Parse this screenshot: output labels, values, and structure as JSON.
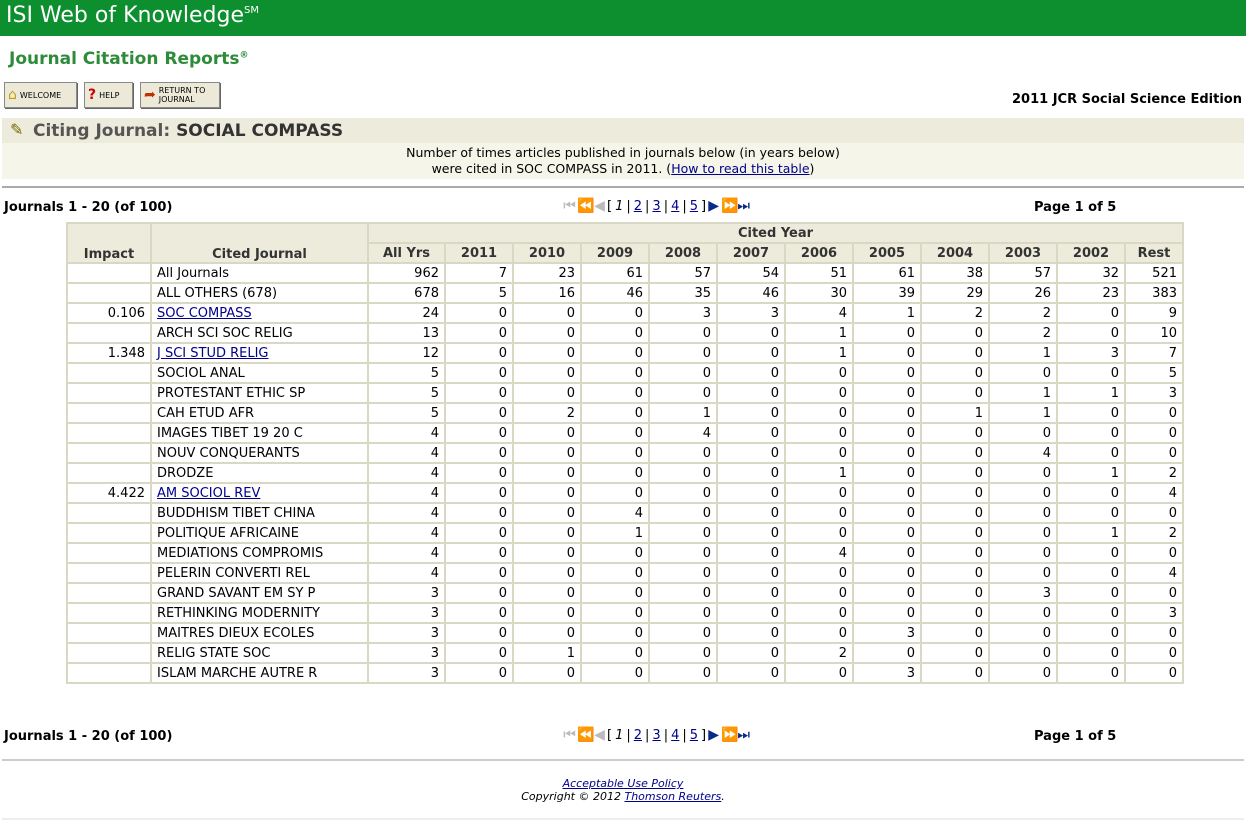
{
  "header": {
    "brand": "ISI Web of Knowledge",
    "brand_mark": "SM",
    "product": "Journal Citation Reports",
    "product_mark": "®"
  },
  "toolbar": {
    "welcome": "WELCOME",
    "help": "HELP",
    "return_line1": "RETURN TO",
    "return_line2": "JOURNAL"
  },
  "edition": "2011 JCR Social Science Edition",
  "citing": {
    "label": "Citing Journal:",
    "journal": "SOCIAL COMPASS"
  },
  "description": {
    "line1": "Number of times articles published in journals below (in years below)",
    "line2": "were cited in SOC COMPASS in 2011. (",
    "link": "How to read this table",
    "line2_end": ")"
  },
  "nav": {
    "range": "Journals 1 - 20 (of 100)",
    "page_status": "Page 1 of 5",
    "open_bracket": "[",
    "close_bracket": "]",
    "current_page": "1",
    "pages": [
      "2",
      "3",
      "4",
      "5"
    ],
    "sep": "|"
  },
  "table": {
    "impact_header": "Impact",
    "journal_header": "Cited Journal",
    "year_group_header": "Cited Year",
    "year_headers": [
      "All Yrs",
      "2011",
      "2010",
      "2009",
      "2008",
      "2007",
      "2006",
      "2005",
      "2004",
      "2003",
      "2002",
      "Rest"
    ],
    "rows": [
      {
        "impact": "",
        "journal": "All Journals",
        "link": false,
        "values": [
          "962",
          "7",
          "23",
          "61",
          "57",
          "54",
          "51",
          "61",
          "38",
          "57",
          "32",
          "521"
        ]
      },
      {
        "impact": "",
        "journal": "ALL OTHERS (678)",
        "link": false,
        "values": [
          "678",
          "5",
          "16",
          "46",
          "35",
          "46",
          "30",
          "39",
          "29",
          "26",
          "23",
          "383"
        ]
      },
      {
        "impact": "0.106",
        "journal": "SOC COMPASS",
        "link": true,
        "values": [
          "24",
          "0",
          "0",
          "0",
          "3",
          "3",
          "4",
          "1",
          "2",
          "2",
          "0",
          "9"
        ]
      },
      {
        "impact": "",
        "journal": "ARCH SCI SOC RELIG",
        "link": false,
        "values": [
          "13",
          "0",
          "0",
          "0",
          "0",
          "0",
          "1",
          "0",
          "0",
          "2",
          "0",
          "10"
        ]
      },
      {
        "impact": "1.348",
        "journal": "J SCI STUD RELIG",
        "link": true,
        "values": [
          "12",
          "0",
          "0",
          "0",
          "0",
          "0",
          "1",
          "0",
          "0",
          "1",
          "3",
          "7"
        ]
      },
      {
        "impact": "",
        "journal": "SOCIOL ANAL",
        "link": false,
        "values": [
          "5",
          "0",
          "0",
          "0",
          "0",
          "0",
          "0",
          "0",
          "0",
          "0",
          "0",
          "5"
        ]
      },
      {
        "impact": "",
        "journal": "PROTESTANT ETHIC SP",
        "link": false,
        "values": [
          "5",
          "0",
          "0",
          "0",
          "0",
          "0",
          "0",
          "0",
          "0",
          "1",
          "1",
          "3"
        ]
      },
      {
        "impact": "",
        "journal": "CAH ETUD AFR",
        "link": false,
        "values": [
          "5",
          "0",
          "2",
          "0",
          "1",
          "0",
          "0",
          "0",
          "1",
          "1",
          "0",
          "0"
        ]
      },
      {
        "impact": "",
        "journal": "IMAGES TIBET 19 20 C",
        "link": false,
        "values": [
          "4",
          "0",
          "0",
          "0",
          "4",
          "0",
          "0",
          "0",
          "0",
          "0",
          "0",
          "0"
        ]
      },
      {
        "impact": "",
        "journal": "NOUV CONQUERANTS",
        "link": false,
        "values": [
          "4",
          "0",
          "0",
          "0",
          "0",
          "0",
          "0",
          "0",
          "0",
          "4",
          "0",
          "0"
        ]
      },
      {
        "impact": "",
        "journal": "DRODZE",
        "link": false,
        "values": [
          "4",
          "0",
          "0",
          "0",
          "0",
          "0",
          "1",
          "0",
          "0",
          "0",
          "1",
          "2"
        ]
      },
      {
        "impact": "4.422",
        "journal": "AM SOCIOL REV",
        "link": true,
        "values": [
          "4",
          "0",
          "0",
          "0",
          "0",
          "0",
          "0",
          "0",
          "0",
          "0",
          "0",
          "4"
        ]
      },
      {
        "impact": "",
        "journal": "BUDDHISM TIBET CHINA",
        "link": false,
        "values": [
          "4",
          "0",
          "0",
          "4",
          "0",
          "0",
          "0",
          "0",
          "0",
          "0",
          "0",
          "0"
        ]
      },
      {
        "impact": "",
        "journal": "POLITIQUE AFRICAINE",
        "link": false,
        "values": [
          "4",
          "0",
          "0",
          "1",
          "0",
          "0",
          "0",
          "0",
          "0",
          "0",
          "1",
          "2"
        ]
      },
      {
        "impact": "",
        "journal": "MEDIATIONS COMPROMIS",
        "link": false,
        "values": [
          "4",
          "0",
          "0",
          "0",
          "0",
          "0",
          "4",
          "0",
          "0",
          "0",
          "0",
          "0"
        ]
      },
      {
        "impact": "",
        "journal": "PELERIN CONVERTI REL",
        "link": false,
        "values": [
          "4",
          "0",
          "0",
          "0",
          "0",
          "0",
          "0",
          "0",
          "0",
          "0",
          "0",
          "4"
        ]
      },
      {
        "impact": "",
        "journal": "GRAND SAVANT EM SY P",
        "link": false,
        "values": [
          "3",
          "0",
          "0",
          "0",
          "0",
          "0",
          "0",
          "0",
          "0",
          "3",
          "0",
          "0"
        ]
      },
      {
        "impact": "",
        "journal": "RETHINKING MODERNITY",
        "link": false,
        "values": [
          "3",
          "0",
          "0",
          "0",
          "0",
          "0",
          "0",
          "0",
          "0",
          "0",
          "0",
          "3"
        ]
      },
      {
        "impact": "",
        "journal": "MAITRES DIEUX ECOLES",
        "link": false,
        "values": [
          "3",
          "0",
          "0",
          "0",
          "0",
          "0",
          "0",
          "3",
          "0",
          "0",
          "0",
          "0"
        ]
      },
      {
        "impact": "",
        "journal": "RELIG STATE SOC",
        "link": false,
        "values": [
          "3",
          "0",
          "1",
          "0",
          "0",
          "0",
          "2",
          "0",
          "0",
          "0",
          "0",
          "0"
        ]
      },
      {
        "impact": "",
        "journal": "ISLAM MARCHE AUTRE R",
        "link": false,
        "values": [
          "3",
          "0",
          "0",
          "0",
          "0",
          "0",
          "0",
          "3",
          "0",
          "0",
          "0",
          "0"
        ]
      }
    ]
  },
  "footer": {
    "policy": "Acceptable Use Policy",
    "copyright": "Copyright © 2012 ",
    "company": "Thomson Reuters",
    "period": "."
  },
  "colors": {
    "header_green": "#0d8f2f",
    "title_green": "#2e8b3a",
    "link_blue": "#00008b",
    "table_header_bg": "#ecebdc"
  }
}
